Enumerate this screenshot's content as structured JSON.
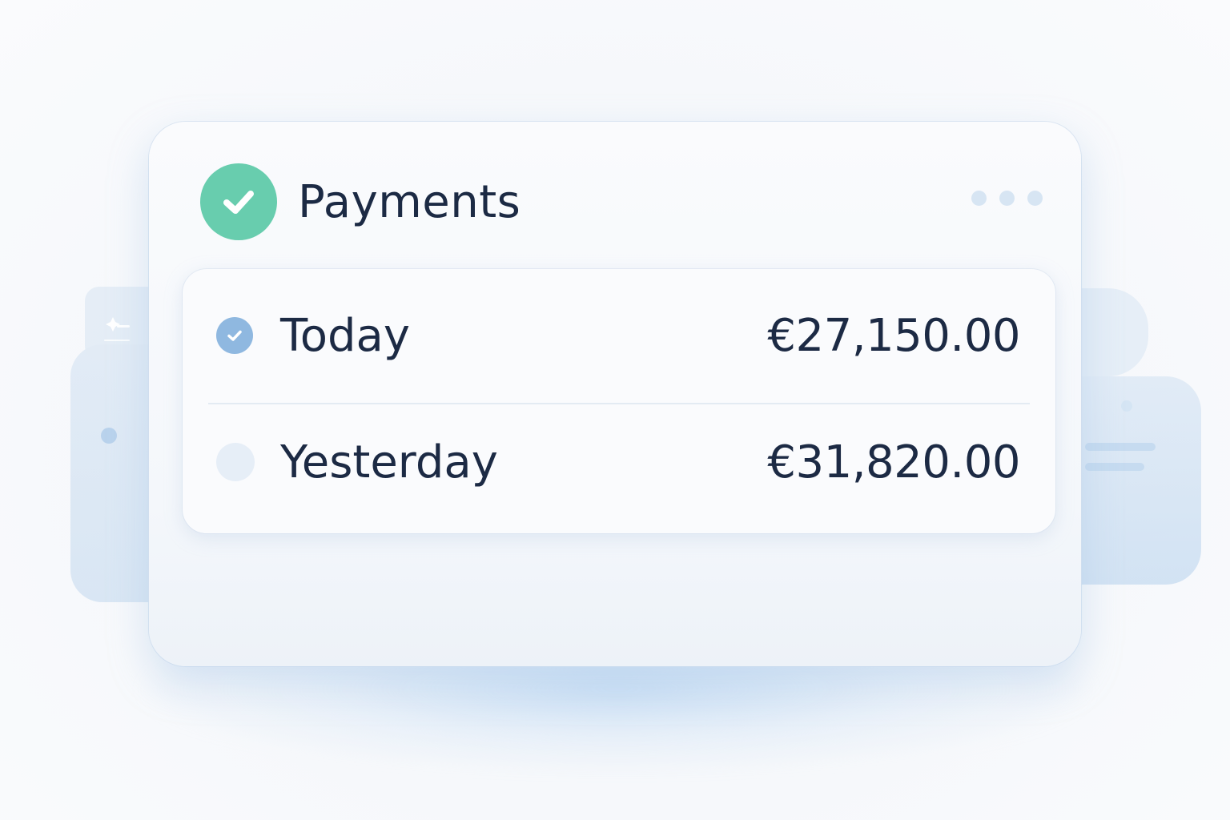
{
  "card": {
    "title": "Payments",
    "title_icon": "check-circle-icon",
    "menu_icon": "more-horizontal-icon"
  },
  "payments": [
    {
      "label": "Today",
      "amount": "€27,150.00",
      "status": "checked"
    },
    {
      "label": "Yesterday",
      "amount": "€31,820.00",
      "status": "unchecked"
    }
  ],
  "colors": {
    "accent_green": "#68cdae",
    "check_blue": "#8fb8e0",
    "text_dark": "#1c2a44",
    "pending_circle": "#e6eef7"
  }
}
